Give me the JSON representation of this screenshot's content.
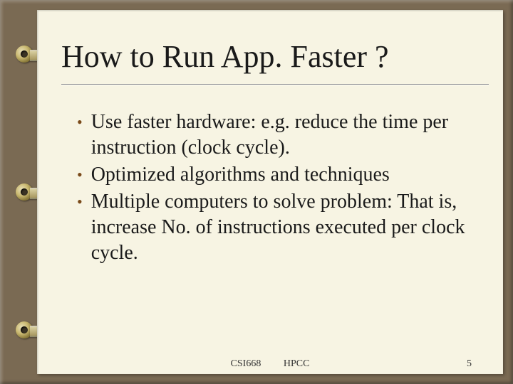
{
  "title": "How to Run App. Faster ?",
  "bullets": [
    "Use faster hardware: e.g. reduce the time per instruction (clock cycle).",
    "Optimized algorithms and techniques",
    "Multiple computers to solve problem: That is, increase No. of instructions executed per clock cycle."
  ],
  "footer": {
    "left": "CSI668",
    "right": "HPCC",
    "page": "5"
  }
}
